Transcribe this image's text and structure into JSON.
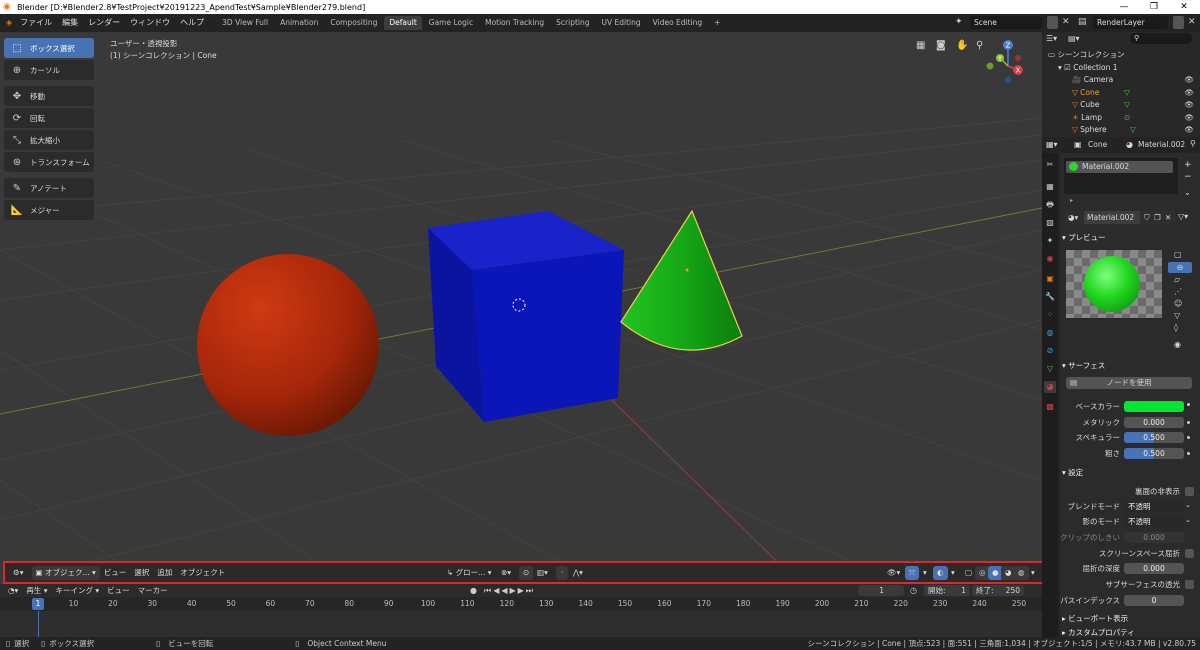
{
  "titlebar": {
    "title": "Blender [D:¥Blender2.8¥TestProject¥20191223_ApendTest¥Sample¥Blender279.blend]",
    "minimize": "—",
    "maximize": "❐",
    "close": "✕"
  },
  "menu": [
    "ファイル",
    "編集",
    "レンダー",
    "ウィンドウ",
    "ヘルプ"
  ],
  "workspaces": [
    "3D View Full",
    "Animation",
    "Compositing",
    "Default",
    "Game Logic",
    "Motion Tracking",
    "Scripting",
    "UV Editing",
    "Video Editing"
  ],
  "workspace_add": "+",
  "scene": "Scene",
  "render_layer": "RenderLayer",
  "tools": {
    "select_box": "ボックス選択",
    "cursor": "カーソル",
    "move": "移動",
    "rotate": "回転",
    "scale": "拡大縮小",
    "transform": "トランスフォーム",
    "annotate": "アノテート",
    "measure": "メジャー"
  },
  "viewport_info": {
    "line1": "ユーザー・透視投影",
    "line2": "(1) シーンコレクション | Cone"
  },
  "gizmo": {
    "x": "X",
    "y": "Y",
    "z": "Z"
  },
  "header": {
    "mode": "オブジェク...",
    "view": "ビュー",
    "select": "選択",
    "add": "追加",
    "object": "オブジェクト",
    "orientation": "グロー..."
  },
  "timeline": {
    "playback": "再生",
    "keying": "キーイング",
    "view": "ビュー",
    "marker": "マーカー",
    "current_frame": "1",
    "start_label": "開始:",
    "start": "1",
    "end_label": "終了:",
    "end": "250",
    "ticks": [
      "1",
      "10",
      "20",
      "30",
      "40",
      "50",
      "60",
      "70",
      "80",
      "90",
      "100",
      "110",
      "120",
      "130",
      "140",
      "150",
      "160",
      "170",
      "180",
      "190",
      "200",
      "210",
      "220",
      "230",
      "240",
      "250"
    ]
  },
  "status": {
    "select": "選択",
    "box_select": "ボックス選択",
    "rotate_view": "ビューを回転",
    "context_menu": "Object Context Menu",
    "stats": "シーンコレクション | Cone | 頂点:523 | 面:551 | 三角面:1,034 | オブジェクト:1/5 | メモリ:43.7 MB | v2.80.75"
  },
  "outliner": {
    "root": "シーンコレクション",
    "collection": "Collection 1",
    "items": [
      "Camera",
      "Cone",
      "Cube",
      "Lamp",
      "Sphere"
    ]
  },
  "properties": {
    "object": "Cone",
    "material": "Material.002",
    "slot": "Material.002",
    "mat_name": "Material.002",
    "preview_title": "プレビュー",
    "surface_title": "サーフェス",
    "use_nodes": "ノードを使用",
    "base_color_label": "ベースカラー",
    "metallic_label": "メタリック",
    "metallic": "0.000",
    "specular_label": "スペキュラー",
    "specular": "0.500",
    "roughness_label": "粗さ",
    "roughness": "0.500",
    "settings_title": "設定",
    "backface_label": "裏面の非表示",
    "blend_mode_label": "ブレンドモード",
    "blend_mode": "不透明",
    "shadow_mode_label": "影のモード",
    "shadow_mode": "不透明",
    "clip_label": "クリップのしきい",
    "clip": "0.000",
    "ssr_label": "スクリーンスペース屈折",
    "refraction_label": "屈折の深度",
    "refraction": "0.000",
    "sss_label": "サブサーフェスの透光",
    "pass_label": "パスインデックス",
    "pass": "0",
    "viewport_display": "ビューポート表示",
    "custom_props": "カスタムプロパティ"
  },
  "colors": {
    "accent": "#4772b3",
    "base_color": "#00e633",
    "highlight_box": "#e0262b",
    "sphere": "#b32a0a",
    "cube": "#0a1fb3",
    "cone": "#1fa81f"
  }
}
